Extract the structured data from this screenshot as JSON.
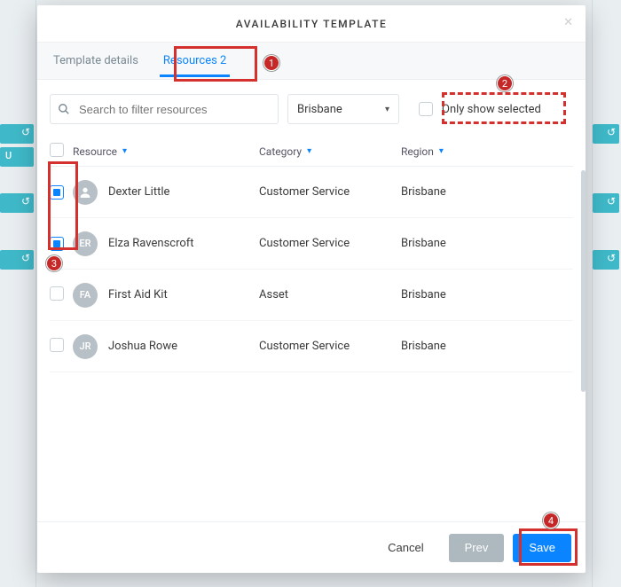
{
  "modal": {
    "title": "AVAILABILITY TEMPLATE"
  },
  "tabs": {
    "details": "Template details",
    "resources_label": "Resources",
    "resources_count": "2"
  },
  "search": {
    "placeholder": "Search to filter resources"
  },
  "region_select": {
    "value": "Brisbane"
  },
  "only_selected": {
    "label": "Only show selected"
  },
  "columns": {
    "resource": "Resource",
    "category": "Category",
    "region": "Region"
  },
  "rows": [
    {
      "checked": true,
      "initials": "",
      "person_icon": true,
      "name": "Dexter Little",
      "category": "Customer Service",
      "region": "Brisbane"
    },
    {
      "checked": true,
      "initials": "ER",
      "person_icon": false,
      "name": "Elza Ravenscroft",
      "category": "Customer Service",
      "region": "Brisbane"
    },
    {
      "checked": false,
      "initials": "FA",
      "person_icon": false,
      "name": "First Aid Kit",
      "category": "Asset",
      "region": "Brisbane"
    },
    {
      "checked": false,
      "initials": "JR",
      "person_icon": false,
      "name": "Joshua Rowe",
      "category": "Customer Service",
      "region": "Brisbane"
    }
  ],
  "footer": {
    "cancel": "Cancel",
    "prev": "Prev",
    "save": "Save"
  },
  "annotations": {
    "b1": "1",
    "b2": "2",
    "b3": "3",
    "b4": "4"
  },
  "background_bars": {
    "u_label": "U"
  }
}
